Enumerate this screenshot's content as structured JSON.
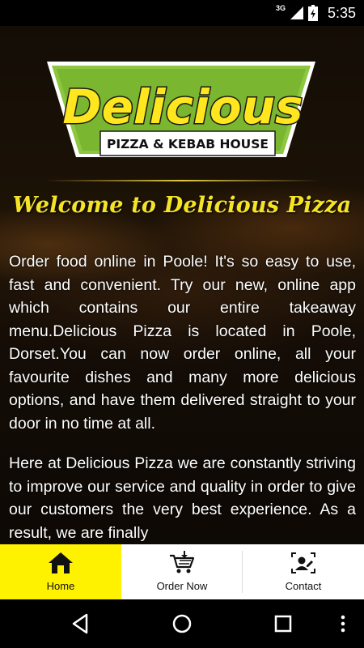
{
  "status_bar": {
    "network": "3G",
    "time": "5:35"
  },
  "logo": {
    "title": "Delicious",
    "subtitle": "PIZZA & KEBAB HOUSE"
  },
  "welcome_title": "Welcome to Delicious Pizza",
  "paragraphs": [
    "Order food online in Poole! It's so easy to use, fast and convenient. Try our new, online app which contains our entire takeaway menu.Delicious Pizza is located in Poole, Dorset.You can now order online, all your favourite dishes and many more delicious options, and have them delivered straight to your door in no time at all.",
    "Here at Delicious Pizza we are constantly striving to improve our service and quality in order to give our customers the very best experience. As a result, we are finally"
  ],
  "bottom_nav": {
    "items": [
      {
        "label": "Home",
        "icon": "home-icon",
        "active": true
      },
      {
        "label": "Order Now",
        "icon": "cart-icon",
        "active": false
      },
      {
        "label": "Contact",
        "icon": "contact-icon",
        "active": false
      }
    ],
    "active_color": "#fff200"
  },
  "colors": {
    "welcome_text": "#f5e325",
    "logo_green": "#8dc63f",
    "logo_yellow": "#ffe61f"
  }
}
